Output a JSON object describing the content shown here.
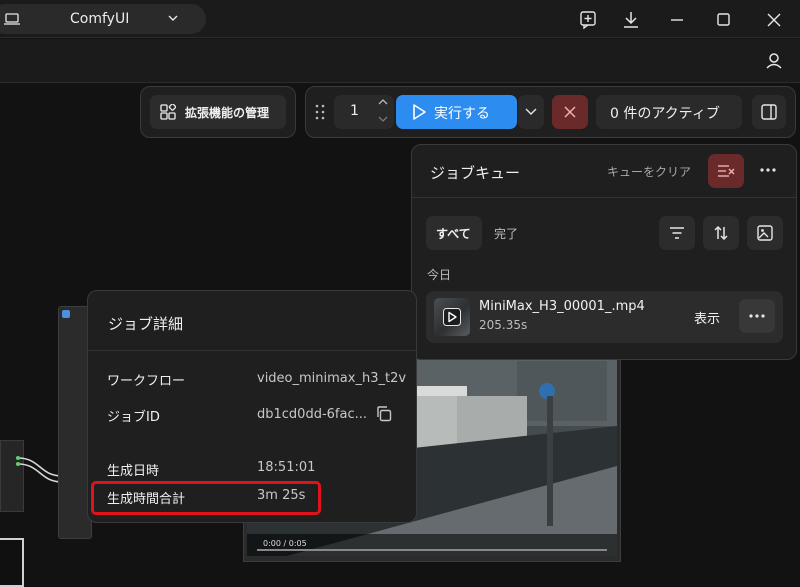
{
  "titlebar": {
    "app_title": "ComfyUI",
    "icons": [
      "laptop-icon",
      "chevron-down-icon",
      "new-tab-icon",
      "download-icon",
      "minimize-icon",
      "maximize-icon",
      "close-icon"
    ]
  },
  "toolbar": {
    "extensions_label": "拡張機能の管理",
    "run_count": "1",
    "run_label": "実行する",
    "active_label": "0 件のアクティブ"
  },
  "queue": {
    "title": "ジョブキュー",
    "clear_label": "キューをクリア",
    "tabs": [
      "すべて",
      "完了"
    ],
    "group_label": "今日",
    "item": {
      "name": "MiniMax_H3_00001_.mp4",
      "duration": "205.35s",
      "show_label": "表示"
    }
  },
  "details": {
    "title": "ジョブ詳細",
    "rows": [
      {
        "label": "ワークフロー",
        "value": "video_minimax_h3_t2v"
      },
      {
        "label": "ジョブID",
        "value": "db1cd0dd-6fac..."
      },
      {
        "label": "生成日時",
        "value": "18:51:01"
      },
      {
        "label": "生成時間合計",
        "value": "3m 25s"
      }
    ]
  },
  "video": {
    "time": "0:00 / 0:05"
  },
  "colors": {
    "accent": "#2d8cf0",
    "danger": "#6a2a2a",
    "highlight": "#e0121b"
  }
}
